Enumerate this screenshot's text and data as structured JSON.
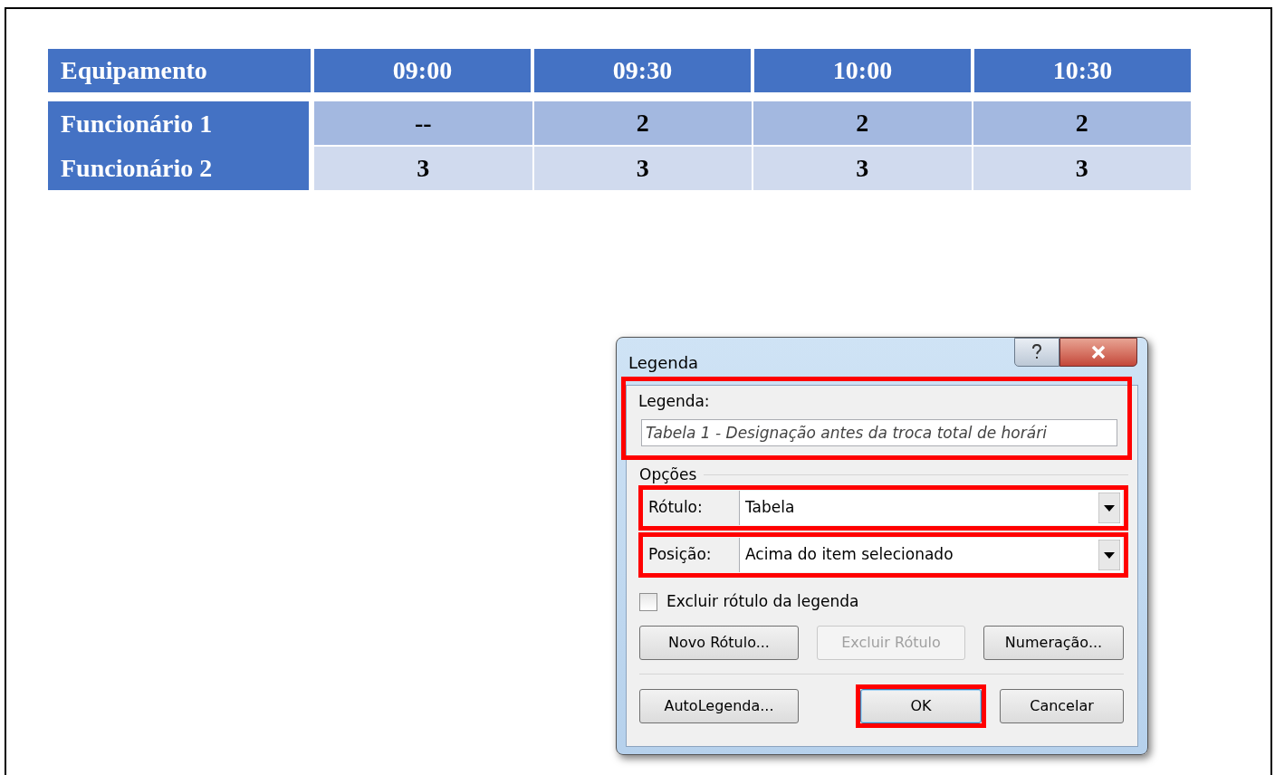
{
  "table": {
    "columns": [
      "Equipamento",
      "09:00",
      "09:30",
      "10:00",
      "10:30"
    ],
    "rows": [
      {
        "cells": [
          "Funcionário 1",
          "--",
          "2",
          "2",
          "2"
        ]
      },
      {
        "cells": [
          "Funcionário 2",
          "3",
          "3",
          "3",
          "3"
        ]
      }
    ]
  },
  "dialog": {
    "title": "Legenda",
    "caption": {
      "label": "Legenda:",
      "value": "Tabela 1 - Designação antes da troca total de horári",
      "highlighted": true
    },
    "options_label": "Opções",
    "selects": [
      {
        "label": "Rótulo:",
        "value": "Tabela",
        "highlighted": true
      },
      {
        "label": "Posição:",
        "value": "Acima do item selecionado",
        "highlighted": true
      }
    ],
    "checkbox": {
      "label": "Excluir rótulo da legenda",
      "checked": false
    },
    "label_buttons": [
      {
        "label": "Novo Rótulo...",
        "disabled": false
      },
      {
        "label": "Excluir Rótulo",
        "disabled": true
      },
      {
        "label": "Numeração...",
        "disabled": false
      }
    ],
    "action_buttons": [
      {
        "label": "AutoLegenda...",
        "default": false,
        "highlighted": false
      },
      {
        "label": "OK",
        "default": true,
        "highlighted": true
      },
      {
        "label": "Cancelar",
        "default": false,
        "highlighted": false
      }
    ]
  }
}
